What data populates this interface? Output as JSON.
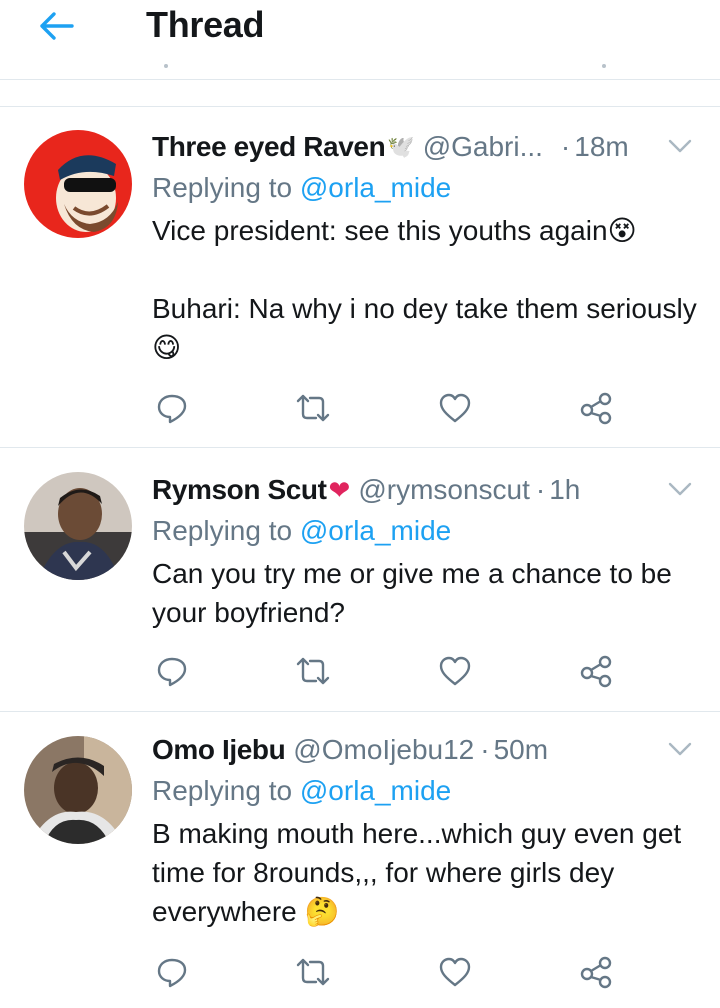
{
  "header": {
    "title": "Thread",
    "back_icon": "arrow-left-icon",
    "accent": "#1da1f2"
  },
  "tweets": [
    {
      "name": "Three eyed Raven",
      "name_emoji": "🕊️",
      "handle": "@Gabri...",
      "separator": "·",
      "time": "18m",
      "replying_prefix": "Replying to",
      "replying_to": "@orla_mide",
      "text": "Vice president: see this youths again😵\n\nBuhari: Na why i no dey take them seriously 😋",
      "avatar_color": "#e8261c"
    },
    {
      "name": "Rymson Scut",
      "name_emoji": "❤",
      "handle": "@rymsonscut",
      "separator": "·",
      "time": "1h",
      "replying_prefix": "Replying to",
      "replying_to": "@orla_mide",
      "text": "Can you try me or give me a chance to be your boyfriend?",
      "avatar_color": "#8a7d74"
    },
    {
      "name": "Omo Ijebu",
      "name_emoji": "",
      "handle": "@OmoIjebu12",
      "separator": "·",
      "time": "50m",
      "replying_prefix": "Replying to",
      "replying_to": "@orla_mide",
      "text": "B making mouth here...which guy even get time for 8rounds,,, for where girls dey everywhere 🤔",
      "avatar_color": "#5b4a3c"
    }
  ],
  "action_icons": [
    "reply-icon",
    "retweet-icon",
    "like-icon",
    "share-icon"
  ],
  "colors": {
    "text": "#14171a",
    "secondary": "#657786",
    "link": "#1da1f2",
    "divider": "#e1e8ed",
    "heart": "#e0245e"
  }
}
